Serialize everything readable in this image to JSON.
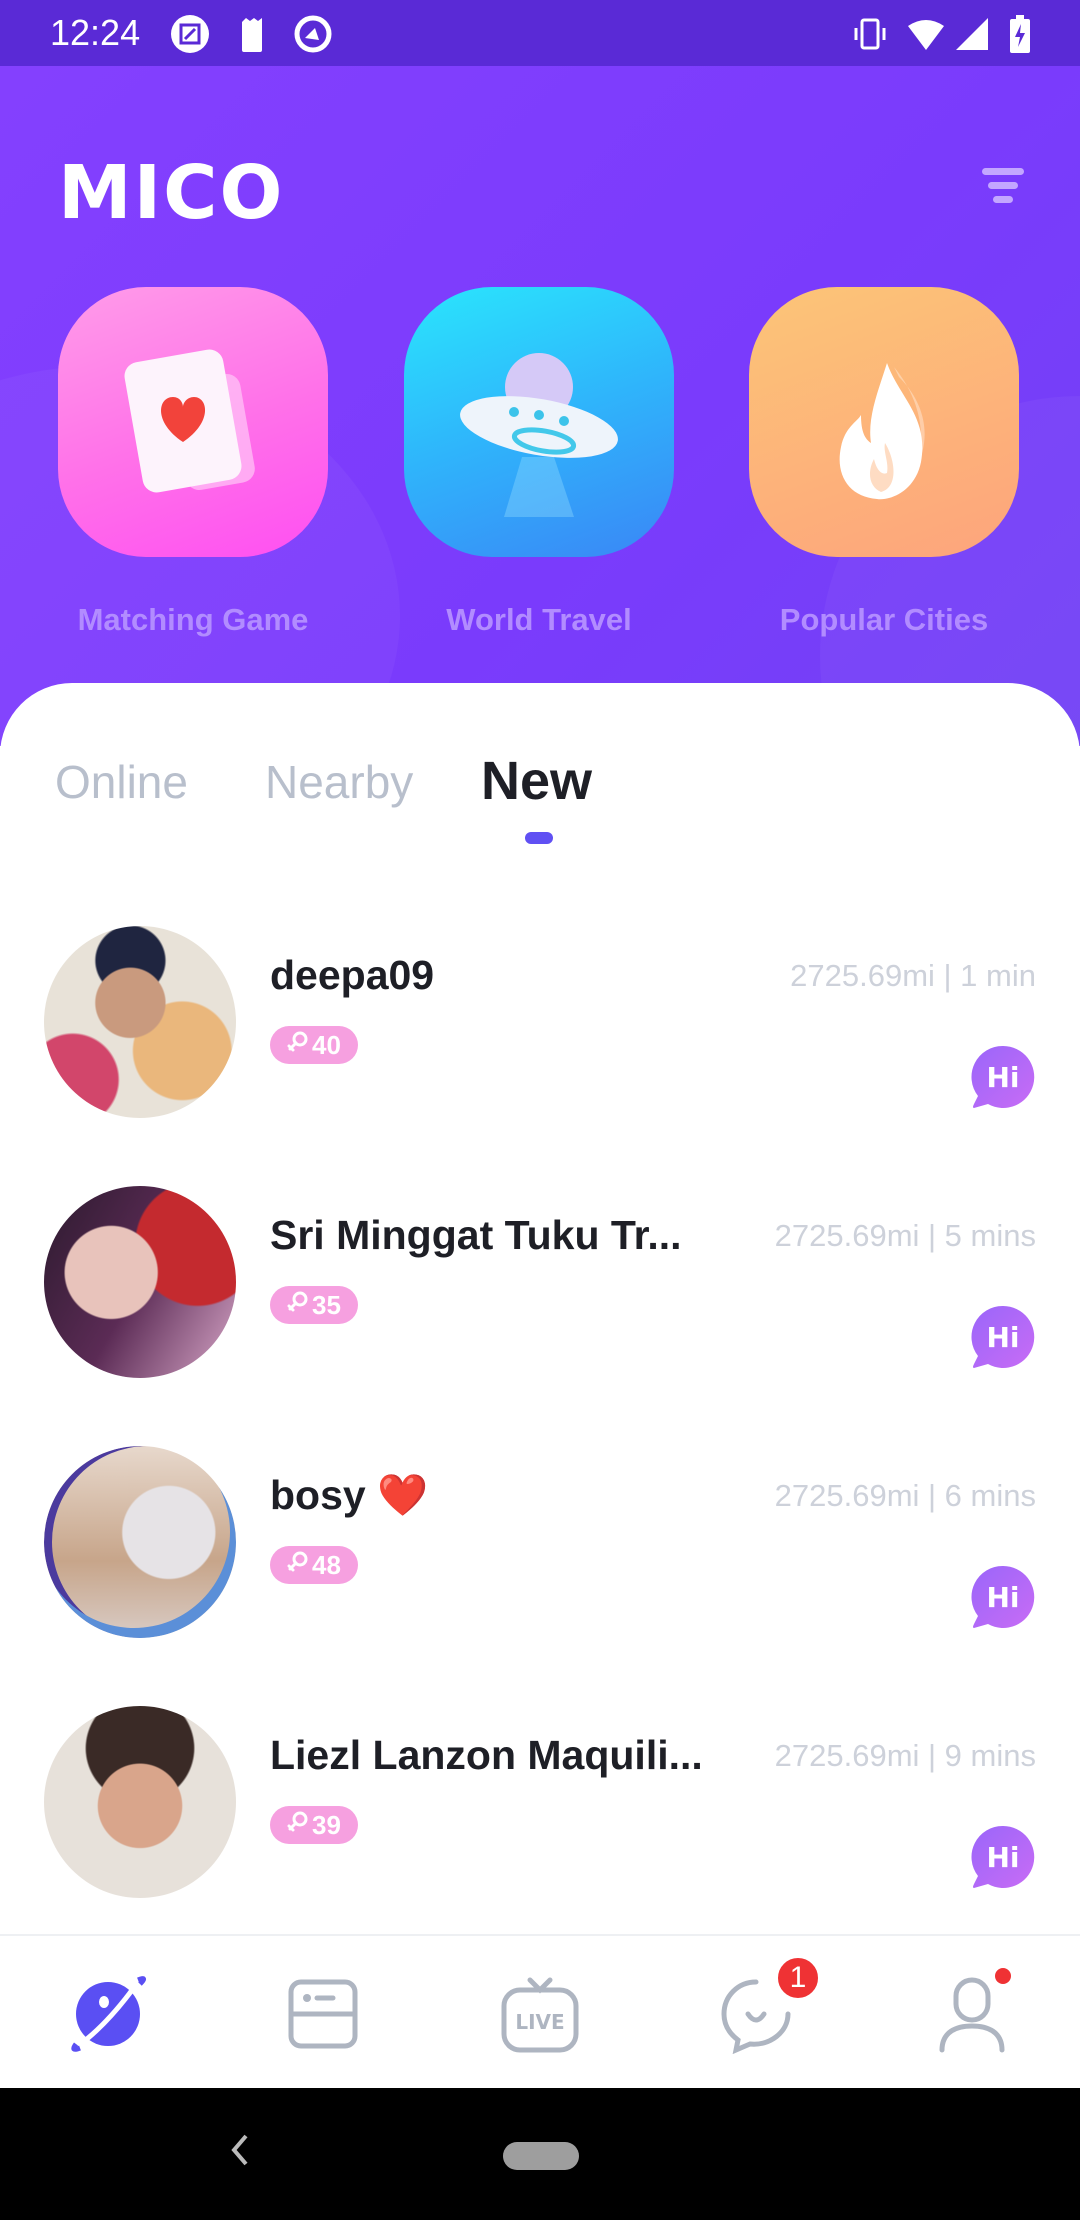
{
  "status_bar": {
    "time": "12:24",
    "left_icons": [
      "screenshot-icon",
      "battery-saver-icon",
      "data-saver-icon"
    ],
    "right_icons": [
      "vibrate-icon",
      "wifi-icon",
      "cell-signal-icon",
      "battery-charging-icon"
    ]
  },
  "header": {
    "logo": "MICO",
    "filter_icon": "filter-icon",
    "accent": "#7f3cfd"
  },
  "features": [
    {
      "label": "Matching Game",
      "icon": "heart-card-icon",
      "color": "#ff6ff0"
    },
    {
      "label": "World Travel",
      "icon": "ufo-icon",
      "color": "#2fb8fb"
    },
    {
      "label": "Popular Cities",
      "icon": "flame-icon",
      "color": "#fdb37a"
    }
  ],
  "tabs": [
    {
      "label": "Online",
      "active": false
    },
    {
      "label": "Nearby",
      "active": false
    },
    {
      "label": "New",
      "active": true
    }
  ],
  "users": [
    {
      "name": "deepa09",
      "age": "40",
      "gender_icon": "female-icon",
      "distance": "2725.69mi",
      "time": "1 min",
      "meta": "2725.69mi | 1 min",
      "hi_label": "Hi"
    },
    {
      "name": "Sri Minggat Tuku Tr...",
      "age": "35",
      "gender_icon": "female-icon",
      "distance": "2725.69mi",
      "time": "5 mins",
      "meta": "2725.69mi | 5 mins",
      "hi_label": "Hi"
    },
    {
      "name": "bosy ❤️",
      "age": "48",
      "gender_icon": "female-icon",
      "distance": "2725.69mi",
      "time": "6 mins",
      "meta": "2725.69mi | 6 mins",
      "hi_label": "Hi"
    },
    {
      "name": "Liezl Lanzon Maquili...",
      "age": "39",
      "gender_icon": "female-icon",
      "distance": "2725.69mi",
      "time": "9 mins",
      "meta": "2725.69mi | 9 mins",
      "hi_label": "Hi"
    }
  ],
  "bottom_nav": [
    {
      "name": "discover",
      "icon": "planet-icon",
      "active": true
    },
    {
      "name": "feed",
      "icon": "feed-card-icon",
      "active": false
    },
    {
      "name": "live",
      "icon": "live-tv-icon",
      "label": "LIVE",
      "active": false
    },
    {
      "name": "chat",
      "icon": "chat-bubble-icon",
      "badge": "1",
      "active": false
    },
    {
      "name": "profile",
      "icon": "profile-icon",
      "dot": true,
      "active": false
    }
  ],
  "colors": {
    "primary": "#6050f3",
    "badge_pink": "#f6a0e0",
    "notification_red": "#ef3234",
    "hi_gradient_start": "#9a66fa",
    "hi_gradient_end": "#c86cf5"
  }
}
